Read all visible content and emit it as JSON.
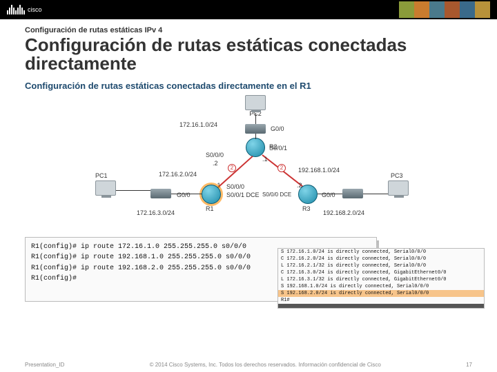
{
  "header": {
    "brand": "cisco"
  },
  "eyebrow": "Configuración de rutas estáticas IPv 4",
  "title": "Configuración de rutas estáticas conectadas directamente",
  "panel_title": "Configuración de rutas estáticas conectadas directamente en el R1",
  "diagram": {
    "pc1": "PC1",
    "pc2": "PC2",
    "pc3": "PC3",
    "r1": "R1",
    "r2": "R2",
    "r3": "R3",
    "net_top": "172.16.1.0/24",
    "net_left_link": "172.16.2.0/24",
    "net_right_link": "192.168.1.0/24",
    "net_left_lan": "172.16.3.0/24",
    "net_right_lan": "192.168.2.0/24",
    "g00": "G0/0",
    "s000": "S0/0/0",
    "s001": "S0/0/1",
    "s000dce": "S0/0/0 DCE",
    "s001dce": "S0/0/1 DCE",
    "p1": ".1",
    "p2": ".2",
    "cost2a": "2",
    "cost2b": "2"
  },
  "cli1": [
    "R1(config)# ip route 172.16.1.0 255.255.255.0 s0/0/0",
    "R1(config)# ip route 192.168.1.0 255.255.255.0 s0/0/0",
    "R1(config)# ip route 192.168.2.0 255.255.255.0 s0/0/0",
    "R1(config)#"
  ],
  "cli2": [
    {
      "code": "S",
      "text": "172.16.1.0/24 is directly connected, Serial0/0/0"
    },
    {
      "code": "C",
      "text": "172.16.2.0/24 is directly connected, Serial0/0/0"
    },
    {
      "code": "L",
      "text": "172.16.2.1/32 is directly connected, Serial0/0/0"
    },
    {
      "code": "C",
      "text": "172.16.3.0/24 is directly connected, GigabitEthernet0/0"
    },
    {
      "code": "L",
      "text": "172.16.3.1/32 is directly connected, GigabitEthernet0/0"
    },
    {
      "code": "S",
      "text": "192.168.1.0/24 is directly connected, Serial0/0/0"
    },
    {
      "code": "S",
      "text": "192.168.2.0/24 is directly connected, Serial0/0/0",
      "hl": true
    },
    {
      "code": "",
      "text": "R1#"
    }
  ],
  "footer": {
    "left": "Presentation_ID",
    "center": "© 2014 Cisco Systems, Inc. Todos los derechos reservados.   Información confidencial de Cisco",
    "page": "17"
  }
}
